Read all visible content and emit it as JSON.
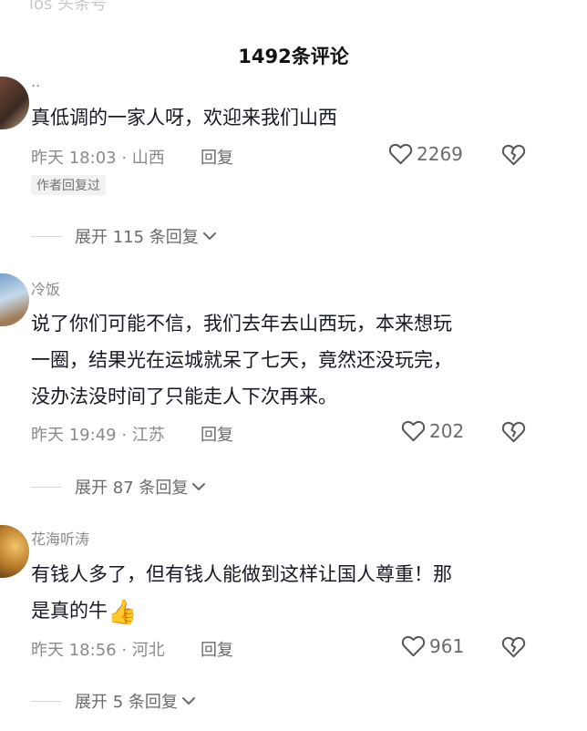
{
  "top_fragment": "ios 头条号",
  "header": {
    "title": "1492条评论"
  },
  "comments": [
    {
      "username": "..",
      "text_lines": [
        "真低调的一家人呀，欢迎来我们山西"
      ],
      "time_location": "昨天 18:03 · 山西",
      "reply_label": "回复",
      "likes": "2269",
      "author_tag": "作者回复过",
      "expand_label": "展开 115 条回复"
    },
    {
      "username": "冷饭",
      "text_lines": [
        "说了你们可能不信，我们去年去山西玩，本来想玩",
        "一圈，结果光在运城就呆了七天，竟然还没玩完，",
        "没办法没时间了只能走人下次再来。"
      ],
      "time_location": "昨天 19:49 · 江苏",
      "reply_label": "回复",
      "likes": "202",
      "expand_label": "展开 87 条回复"
    },
    {
      "username": "花海听涛",
      "text_lines": [
        "有钱人多了，但有钱人能做到这样让国人尊重！那",
        "是真的牛"
      ],
      "emoji": "👍",
      "time_location": "昨天 18:56 · 河北",
      "reply_label": "回复",
      "likes": "961",
      "expand_label": "展开 5 条回复"
    }
  ],
  "icons": {
    "like": "heart-outline-icon",
    "dislike": "broken-heart-icon",
    "expand": "chevron-down-icon"
  },
  "colors": {
    "text": "#161823",
    "secondary": "#8a8a8a",
    "tag_bg": "#f2f2f2"
  }
}
